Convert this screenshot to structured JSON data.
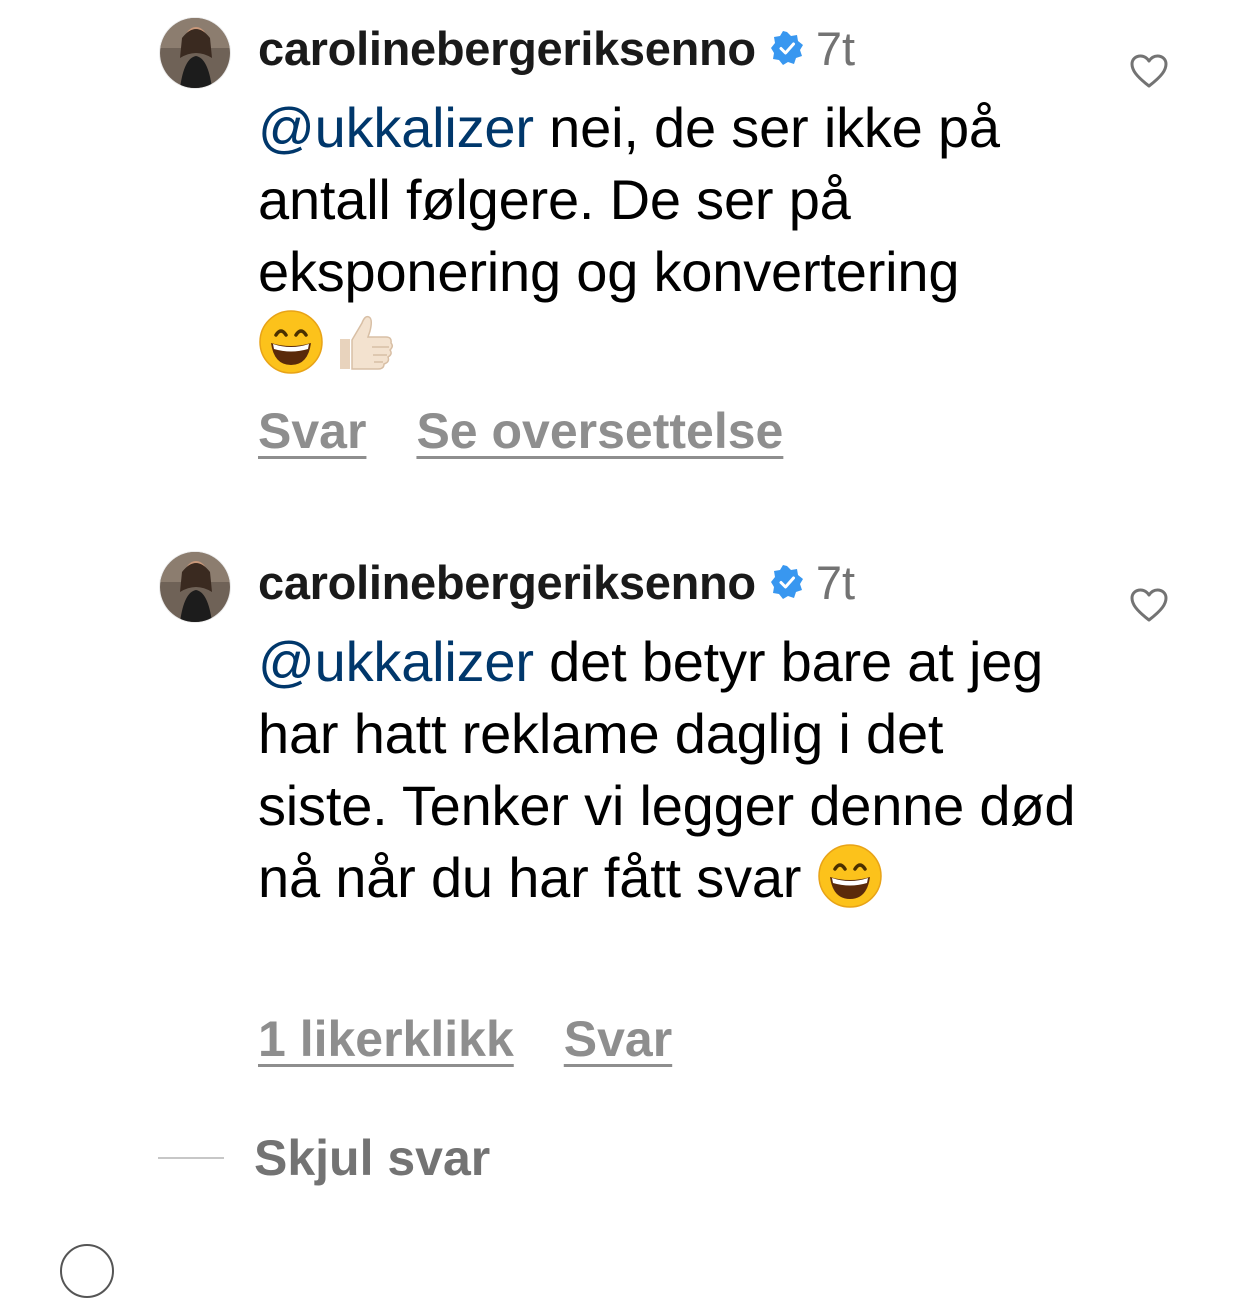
{
  "comments": [
    {
      "username": "carolinebergeriksenno",
      "time": "7t",
      "mention": "@ukkalizer",
      "text": " nei, de ser ikke på antall følgere. De ser på eksponering og konvertering",
      "emojis": [
        "grinning-face",
        "thumbs-up-light-skin"
      ],
      "actions": {
        "reply": "Svar",
        "translate": "Se oversettelse"
      }
    },
    {
      "username": "carolinebergeriksenno",
      "time": "7t",
      "mention": "@ukkalizer",
      "text": " det betyr bare at jeg har hatt reklame daglig i det siste. Tenker vi legger denne død nå når du har fått svar",
      "emojis": [
        "grinning-face"
      ],
      "actions": {
        "likes": "1 likerklikk",
        "reply": "Svar"
      }
    }
  ],
  "hide_replies": "Skjul svar",
  "icons": {
    "verified": "verified-badge-icon",
    "like": "heart-outline-icon"
  },
  "colors": {
    "mention": "#00376b",
    "verified": "#3897f0",
    "secondary": "#8e8e8e"
  }
}
